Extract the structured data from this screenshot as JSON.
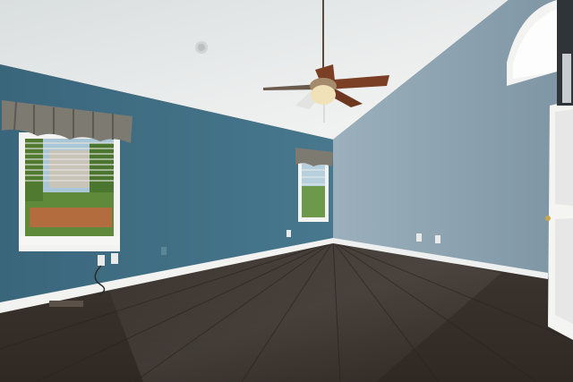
{
  "scene": {
    "description_visible_text": "",
    "colors": {
      "ceiling": "#e3e6e6",
      "left_wall": "#3f6b80",
      "right_wall": "#8ea3b0",
      "floor": "#3b332d",
      "baseboard": "#f2f2f0",
      "curtain": "#7d7a72",
      "door": "#f4f4f2",
      "fan_blade": "#7a3f24"
    },
    "icons": [
      "ceiling-fan-icon",
      "smoke-detector-icon",
      "window-icon",
      "door-icon",
      "outlet-icon"
    ]
  }
}
